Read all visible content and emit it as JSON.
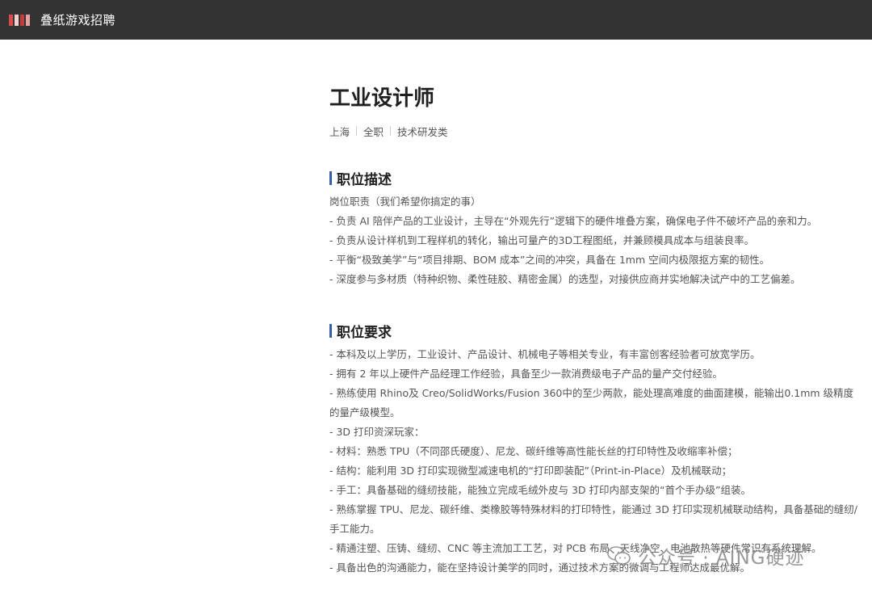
{
  "topbar": {
    "brand_name": "叠纸游戏招聘",
    "logo_colors": [
      "#d94a4a",
      "#e8a0a0",
      "#c23c3c",
      "#f2d0d0"
    ]
  },
  "job": {
    "title": "工业设计师",
    "meta": [
      "上海",
      "全职",
      "技术研发类"
    ]
  },
  "description": {
    "heading": "职位描述",
    "lines": [
      "岗位职责（我们希望你搞定的事）",
      "- 负责 AI 陪伴产品的工业设计，主导在“外观先行”逻辑下的硬件堆叠方案，确保电子件不破坏产品的亲和力。",
      "- 负责从设计样机到工程样机的转化，输出可量产的3D工程图纸，并兼顾模具成本与组装良率。",
      "- 平衡“极致美学”与“项目排期、BOM 成本”之间的冲突，具备在 1mm 空间内极限抠方案的韧性。",
      "- 深度参与多材质（特种织物、柔性硅胶、精密金属）的选型，对接供应商并实地解决试产中的工艺偏差。"
    ]
  },
  "requirements": {
    "heading": "职位要求",
    "lines": [
      "- 本科及以上学历，工业设计、产品设计、机械电子等相关专业，有丰富创客经验者可放宽学历。",
      "- 拥有 2 年以上硬件产品经理工作经验，具备至少一款消费级电子产品的量产交付经验。",
      "- 熟练使用 Rhino及 Creo/SolidWorks/Fusion 360中的至少两款，能处理高难度的曲面建模，能输出0.1mm 级精度的量产级模型。",
      "- 3D 打印资深玩家：",
      "- 材料：熟悉 TPU（不同邵氏硬度）、尼龙、碳纤维等高性能长丝的打印特性及收缩率补偿；",
      "- 结构：能利用 3D 打印实现微型减速电机的“打印即装配”（Print-in-Place）及机械联动；",
      "- 手工：具备基础的缝纫技能，能独立完成毛绒外皮与 3D 打印内部支架的“首个手办级”组装。",
      "- 熟练掌握 TPU、尼龙、碳纤维、类橡胶等特殊材料的打印特性，能通过 3D 打印实现机械联动结构，具备基础的缝纫/手工能力。",
      "- 精通注塑、压铸、缝纫、CNC 等主流加工工艺，对 PCB 布局、天线净空、电池散热等硬件常识有系统理解。",
      "- 具备出色的沟通能力，能在坚持设计美学的同时，通过技术方案的微调与工程师达成最优解。"
    ]
  },
  "watermark": {
    "text": "公众号 · AING硬迹",
    "icon": "wechat-icon"
  }
}
